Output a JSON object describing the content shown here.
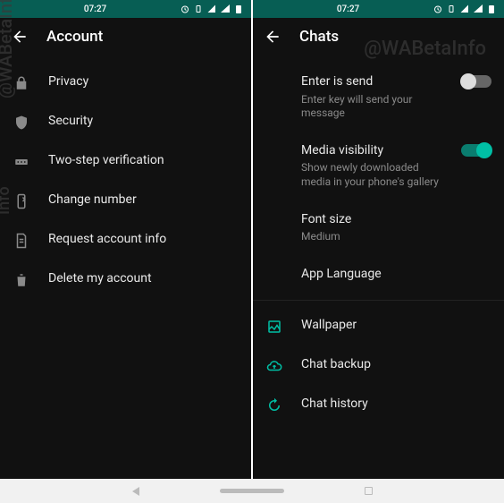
{
  "status": {
    "time": "07:27"
  },
  "watermark": {
    "short1": "@WABetaInfo",
    "short2": "Info",
    "full": "@WABetaInfo"
  },
  "left": {
    "title": "Account",
    "items": [
      {
        "label": "Privacy",
        "icon": "lock-icon"
      },
      {
        "label": "Security",
        "icon": "shield-icon"
      },
      {
        "label": "Two-step verification",
        "icon": "pin-icon"
      },
      {
        "label": "Change number",
        "icon": "phone-icon"
      },
      {
        "label": "Request account info",
        "icon": "document-icon"
      },
      {
        "label": "Delete my account",
        "icon": "trash-icon"
      }
    ]
  },
  "right": {
    "title": "Chats",
    "group1": [
      {
        "label": "Enter is send",
        "sub": "Enter key will send your message",
        "switch": false
      },
      {
        "label": "Media visibility",
        "sub": "Show newly downloaded media in your phone's gallery",
        "switch": true
      },
      {
        "label": "Font size",
        "sub": "Medium"
      },
      {
        "label": "App Language"
      }
    ],
    "group2": [
      {
        "label": "Wallpaper",
        "icon": "wallpaper-icon"
      },
      {
        "label": "Chat backup",
        "icon": "cloud-up-icon"
      },
      {
        "label": "Chat history",
        "icon": "history-icon"
      }
    ]
  }
}
